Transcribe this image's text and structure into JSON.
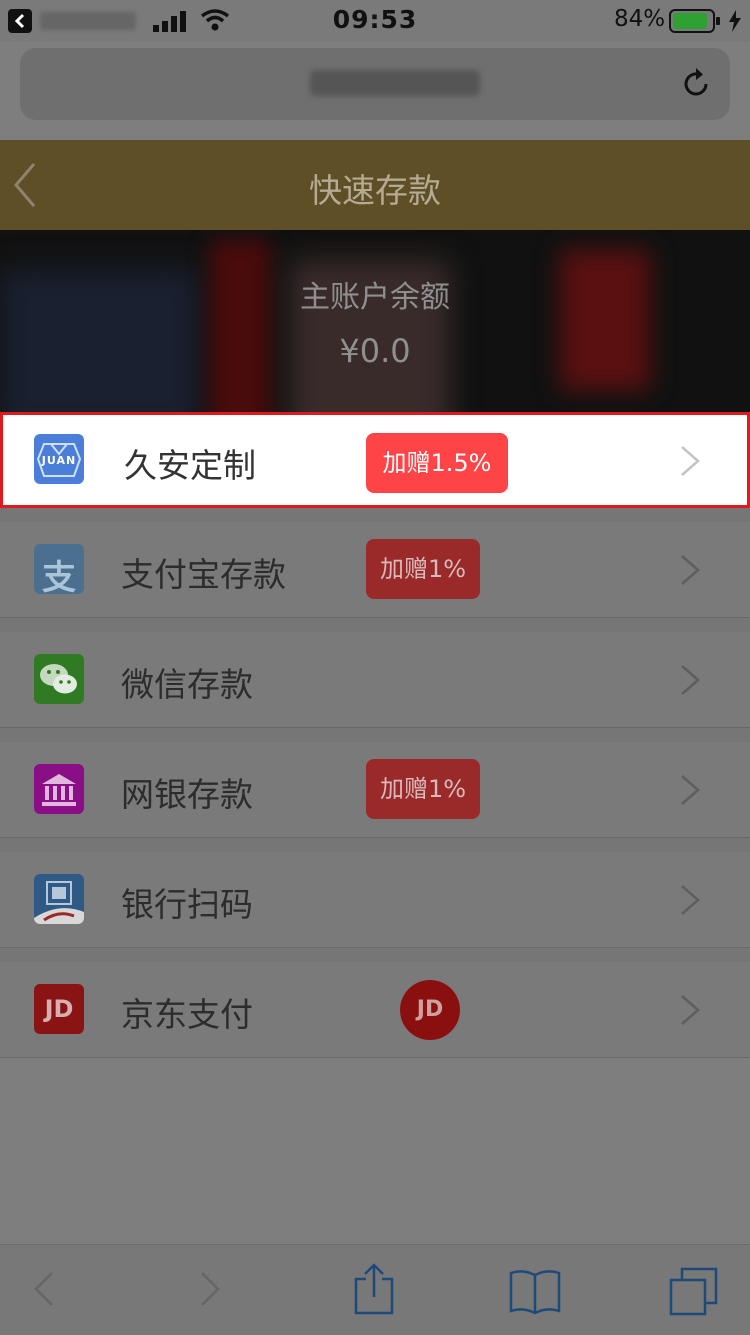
{
  "status_bar": {
    "time": "09:53",
    "battery": "84%"
  },
  "header": {
    "title": "快速存款"
  },
  "balance": {
    "label": "主账户余额",
    "value": "¥0.0"
  },
  "methods": [
    {
      "label": "久安定制",
      "badge": "加赠1.5%",
      "icon": "juan-icon",
      "icon_text": "JUAN"
    },
    {
      "label": "支付宝存款",
      "badge": "加赠1%",
      "icon": "alipay-icon",
      "icon_text": "支"
    },
    {
      "label": "微信存款",
      "badge": "",
      "icon": "wechat-icon"
    },
    {
      "label": "网银存款",
      "badge": "加赠1%",
      "icon": "bank-icon"
    },
    {
      "label": "银行扫码",
      "badge": "",
      "icon": "unionpay-qr-icon"
    },
    {
      "label": "京东支付",
      "badge": "",
      "icon": "jd-icon",
      "icon_text": "JD",
      "round_logo_text": "JD"
    }
  ],
  "colors": {
    "accent_red": "#ff4447",
    "highlight_border": "#e0191f",
    "header_bg": "#5e4f27"
  }
}
